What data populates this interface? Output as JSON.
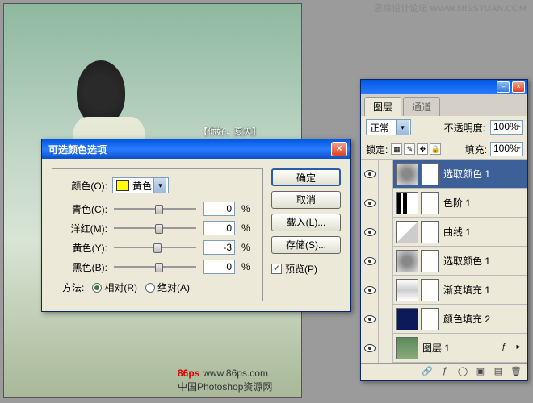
{
  "watermark_top": "思缘设计论坛  WWW.MISSYUAN.COM",
  "photo_text": "【你好，夏天】",
  "logo": "86ps",
  "logo_url": "www.86ps.com",
  "logo_sub": "中国Photoshop资源网",
  "dialog": {
    "title": "可选颜色选项",
    "color_label": "颜色(O):",
    "color_value": "黄色",
    "color_swatch": "#ffff00",
    "sliders": [
      {
        "label": "青色(C):",
        "value": "0",
        "pos": 50
      },
      {
        "label": "洋红(M):",
        "value": "0",
        "pos": 50
      },
      {
        "label": "黄色(Y):",
        "value": "-3",
        "pos": 48
      },
      {
        "label": "黑色(B):",
        "value": "0",
        "pos": 50
      }
    ],
    "method_label": "方法:",
    "method_rel": "相对(R)",
    "method_abs": "绝对(A)",
    "btn_ok": "确定",
    "btn_cancel": "取消",
    "btn_load": "载入(L)...",
    "btn_save": "存储(S)...",
    "chk_preview": "预览(P)"
  },
  "panel": {
    "tab_layers": "图层",
    "tab_channels": "通道",
    "blend_mode": "正常",
    "opacity_label": "不透明度:",
    "opacity_value": "100%",
    "lock_label": "锁定:",
    "fill_label": "填充:",
    "fill_value": "100%",
    "layers": [
      {
        "name": "选取颜色 1",
        "type": "adj",
        "sel": true
      },
      {
        "name": "色阶 1",
        "type": "levels"
      },
      {
        "name": "曲线 1",
        "type": "curves"
      },
      {
        "name": "选取颜色 1",
        "type": "adj"
      },
      {
        "name": "渐变填充 1",
        "type": "grad"
      },
      {
        "name": "颜色填充 2",
        "type": "solid"
      },
      {
        "name": "图层 1",
        "type": "img",
        "actions": true
      }
    ]
  }
}
